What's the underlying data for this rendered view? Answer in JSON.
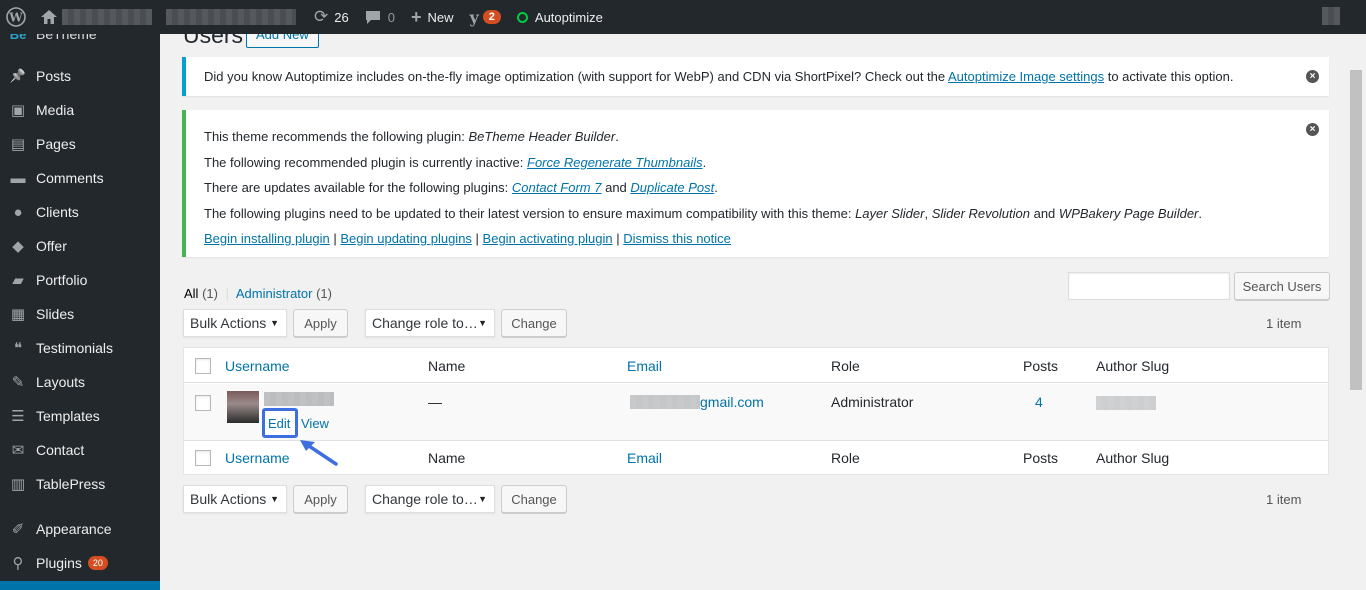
{
  "adminbar": {
    "updates_count": "26",
    "comments_count": "0",
    "new_label": "New",
    "yoast_badge": "2",
    "autoptimize_label": "Autoptimize"
  },
  "sidebar": {
    "site_label": "BeTheme",
    "items": [
      {
        "label": "Posts",
        "icon": "pushpin-icon"
      },
      {
        "label": "Media",
        "icon": "media-icon"
      },
      {
        "label": "Pages",
        "icon": "pages-icon"
      },
      {
        "label": "Comments",
        "icon": "comment-icon"
      },
      {
        "label": "Clients",
        "icon": "user-icon"
      },
      {
        "label": "Offer",
        "icon": "tag-icon"
      },
      {
        "label": "Portfolio",
        "icon": "folder-icon"
      },
      {
        "label": "Slides",
        "icon": "slides-icon"
      },
      {
        "label": "Testimonials",
        "icon": "quote-icon"
      },
      {
        "label": "Layouts",
        "icon": "brush-icon"
      },
      {
        "label": "Templates",
        "icon": "templates-icon"
      },
      {
        "label": "Contact",
        "icon": "mail-icon"
      },
      {
        "label": "TablePress",
        "icon": "table-icon"
      },
      {
        "label": "Appearance",
        "icon": "appearance-icon"
      },
      {
        "label": "Plugins",
        "icon": "plugin-icon",
        "badge": "20"
      }
    ]
  },
  "page": {
    "title": "Users",
    "add_new": "Add New"
  },
  "notice_autoptimize": {
    "text_before": "Did you know Autoptimize includes on-the-fly image optimization (with support for WebP) and CDN via ShortPixel? Check out the",
    "link": "Autoptimize Image settings",
    "text_after": "to activate this option."
  },
  "notice_theme": {
    "line1_prefix": "This theme recommends the following plugin:",
    "line1_plugin": "BeTheme Header Builder",
    "line2_prefix": "The following recommended plugin is currently inactive:",
    "line2_plugin": "Force Regenerate Thumbnails",
    "line3_prefix": "There are updates available for the following plugins:",
    "line3_plugin1": "Contact Form 7",
    "line3_and": "and",
    "line3_plugin2": "Duplicate Post",
    "line4_prefix": "The following plugins need to be updated to their latest version to ensure maximum compatibility with this theme:",
    "line4_plugin1": "Layer Slider",
    "line4_plugin2": "Slider Revolution",
    "line4_and": "and",
    "line4_plugin3": "WPBakery Page Builder",
    "actions": [
      "Begin installing plugin",
      "Begin updating plugins",
      "Begin activating plugin",
      "Dismiss this notice"
    ]
  },
  "filters": {
    "all_label": "All",
    "all_count": "(1)",
    "admin_label": "Administrator",
    "admin_count": "(1)"
  },
  "search": {
    "placeholder": "",
    "button": "Search Users"
  },
  "bulk": {
    "bulk_actions": "Bulk Actions",
    "apply": "Apply",
    "change_role": "Change role to…",
    "change": "Change",
    "item_count": "1 item"
  },
  "table": {
    "headers": {
      "username": "Username",
      "name": "Name",
      "email": "Email",
      "role": "Role",
      "posts": "Posts",
      "author_slug": "Author Slug"
    },
    "rows": [
      {
        "name": "—",
        "email_visible": "gmail.com",
        "role": "Administrator",
        "posts": "4",
        "edit": "Edit",
        "view": "View"
      }
    ]
  },
  "colors": {
    "adminbar": "#23282d",
    "link": "#0073aa",
    "notice_info": "#00a0d2",
    "notice_success": "#46b450",
    "badge": "#d54e21",
    "highlight": "#3d6fe0"
  }
}
